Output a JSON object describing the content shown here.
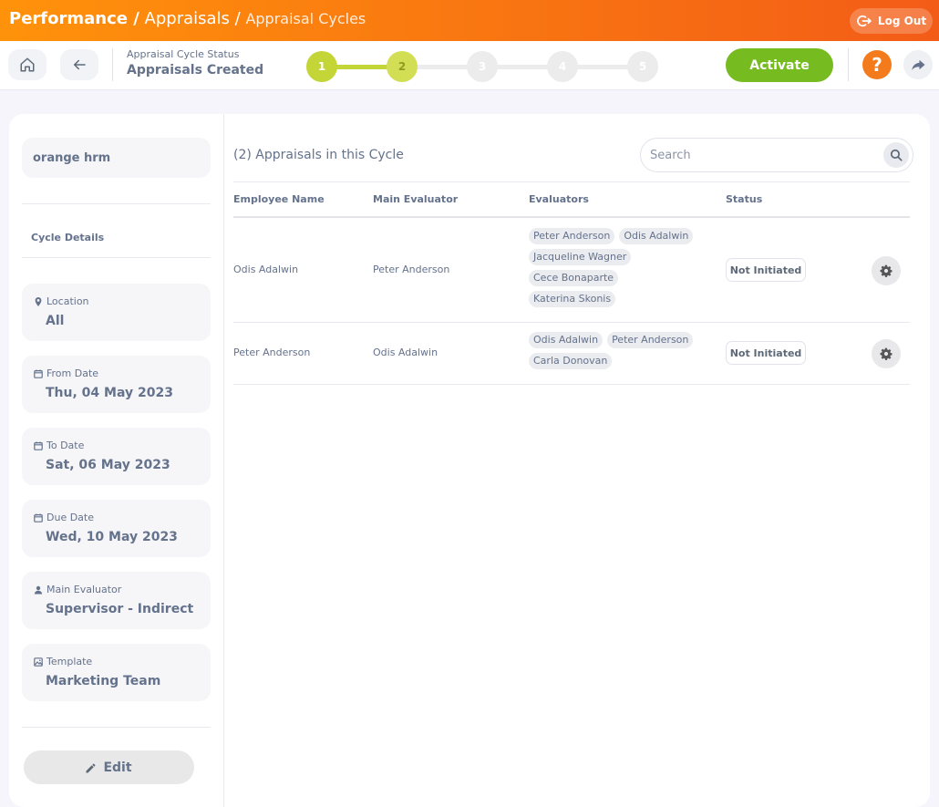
{
  "header": {
    "crumb_module": "Performance /",
    "crumb_section": "Appraisals /",
    "crumb_page": "Appraisal Cycles",
    "logout_label": "Log Out"
  },
  "subbar": {
    "status_caption": "Appraisal Cycle Status",
    "status_value": "Appraisals Created",
    "steps": [
      "1",
      "2",
      "3",
      "4",
      "5"
    ],
    "activate_label": "Activate",
    "help_label": "?"
  },
  "sidebar": {
    "org_name": "orange hrm",
    "cycle_details_title": "Cycle Details",
    "details": [
      {
        "label": "Location",
        "value": "All",
        "icon": "location-pin-icon"
      },
      {
        "label": "From Date",
        "value": "Thu, 04 May 2023",
        "icon": "calendar-icon"
      },
      {
        "label": "To Date",
        "value": "Sat, 06 May 2023",
        "icon": "calendar-icon"
      },
      {
        "label": "Due Date",
        "value": "Wed, 10 May 2023",
        "icon": "calendar-icon"
      },
      {
        "label": "Main Evaluator",
        "value": "Supervisor - Indirect",
        "icon": "person-icon"
      },
      {
        "label": "Template",
        "value": "Marketing Team",
        "icon": "image-icon"
      }
    ],
    "edit_label": "Edit"
  },
  "main": {
    "count_label": "(2) Appraisals in this Cycle",
    "search_placeholder": "Search",
    "columns": [
      "Employee Name",
      "Main Evaluator",
      "Evaluators",
      "Status"
    ],
    "rows": [
      {
        "employee": "Odis Adalwin",
        "main_evaluator": "Peter Anderson",
        "evaluators": [
          "Peter Anderson",
          "Odis Adalwin",
          "Jacqueline Wagner",
          "Cece Bonaparte",
          "Katerina Skonis"
        ],
        "status": "Not Initiated"
      },
      {
        "employee": "Peter Anderson",
        "main_evaluator": "Odis Adalwin",
        "evaluators": [
          "Odis Adalwin",
          "Peter Anderson",
          "Carla Donovan"
        ],
        "status": "Not Initiated"
      }
    ]
  }
}
